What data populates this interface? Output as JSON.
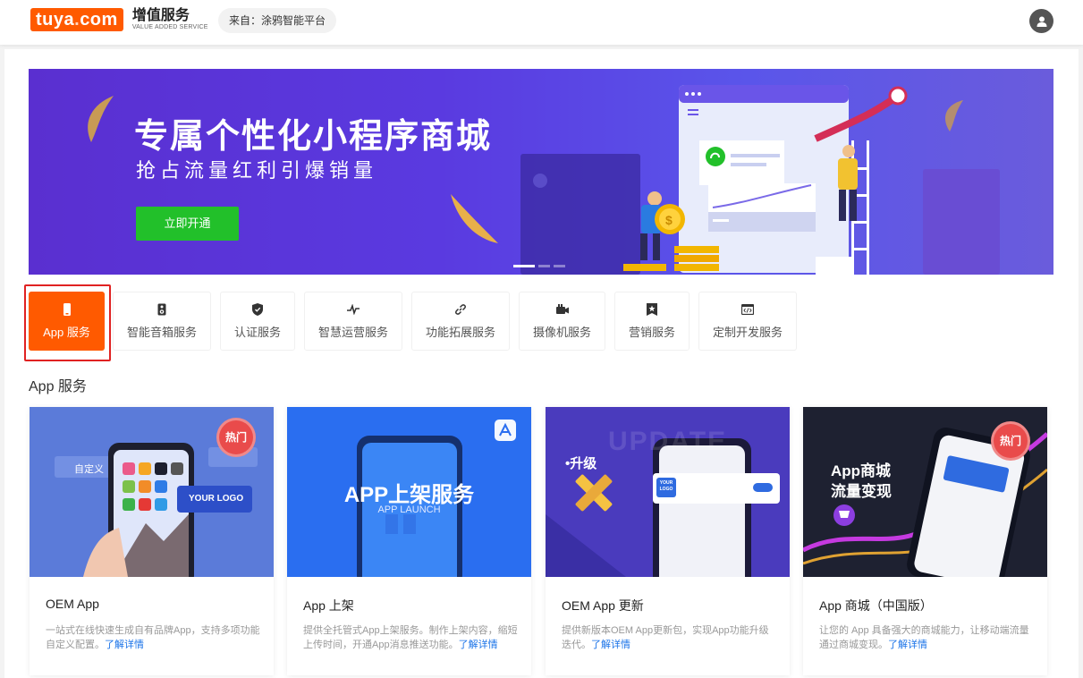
{
  "header": {
    "logo_text": "tuya",
    "logo_dot": "com",
    "brand_title": "增值服务",
    "brand_subtitle": "VALUE ADDED SERVICE",
    "source_label": "来自：涂鸦智能平台",
    "avatar_icon": "user-icon"
  },
  "banner": {
    "title": "专属个性化小程序商城",
    "subtitle": "抢占流量红利引爆销量",
    "cta_label": "立即开通",
    "slides": 3,
    "active_slide": 1
  },
  "tabs": [
    {
      "label": "App 服务",
      "icon": "phone-icon",
      "active": true
    },
    {
      "label": "智能音箱服务",
      "icon": "speaker-icon",
      "active": false
    },
    {
      "label": "认证服务",
      "icon": "shield-icon",
      "active": false
    },
    {
      "label": "智慧运营服务",
      "icon": "pulse-icon",
      "active": false
    },
    {
      "label": "功能拓展服务",
      "icon": "link-icon",
      "active": false
    },
    {
      "label": "摄像机服务",
      "icon": "camera-icon",
      "active": false
    },
    {
      "label": "营销服务",
      "icon": "star-badge-icon",
      "active": false
    },
    {
      "label": "定制开发服务",
      "icon": "code-icon",
      "active": false
    }
  ],
  "section_title": "App 服务",
  "cards": [
    {
      "title": "OEM App",
      "desc": "一站式在线快速生成自有品牌App，支持多项功能自定义配置。",
      "link": "了解详情",
      "badge": "热门",
      "image_texts": {
        "custom": "自定义",
        "logo": "YOUR LOGO"
      }
    },
    {
      "title": "App 上架",
      "desc": "提供全托管式App上架服务。制作上架内容，缩短上传时间，开通App消息推送功能。",
      "link": "了解详情",
      "badge": "",
      "image_texts": {
        "main": "APP上架服务",
        "sub": "APP LAUNCH"
      }
    },
    {
      "title": "OEM App 更新",
      "desc": "提供新版本OEM App更新包，实现App功能升级迭代。",
      "link": "了解详情",
      "badge": "",
      "image_texts": {
        "main": "•升级",
        "bg": "UPDATE",
        "logo": "YOUR LOGO"
      }
    },
    {
      "title": "App 商城（中国版）",
      "desc": "让您的 App 具备强大的商城能力，让移动端流量通过商城变现。",
      "link": "了解详情",
      "badge": "热门",
      "image_texts": {
        "line1": "App商城",
        "line2": "流量变现"
      }
    }
  ],
  "colors": {
    "brand_orange": "#ff5a00",
    "cta_green": "#22c02a",
    "link_blue": "#1a73e8",
    "badge_red": "#e94b4b",
    "highlight_red": "#e02222"
  }
}
